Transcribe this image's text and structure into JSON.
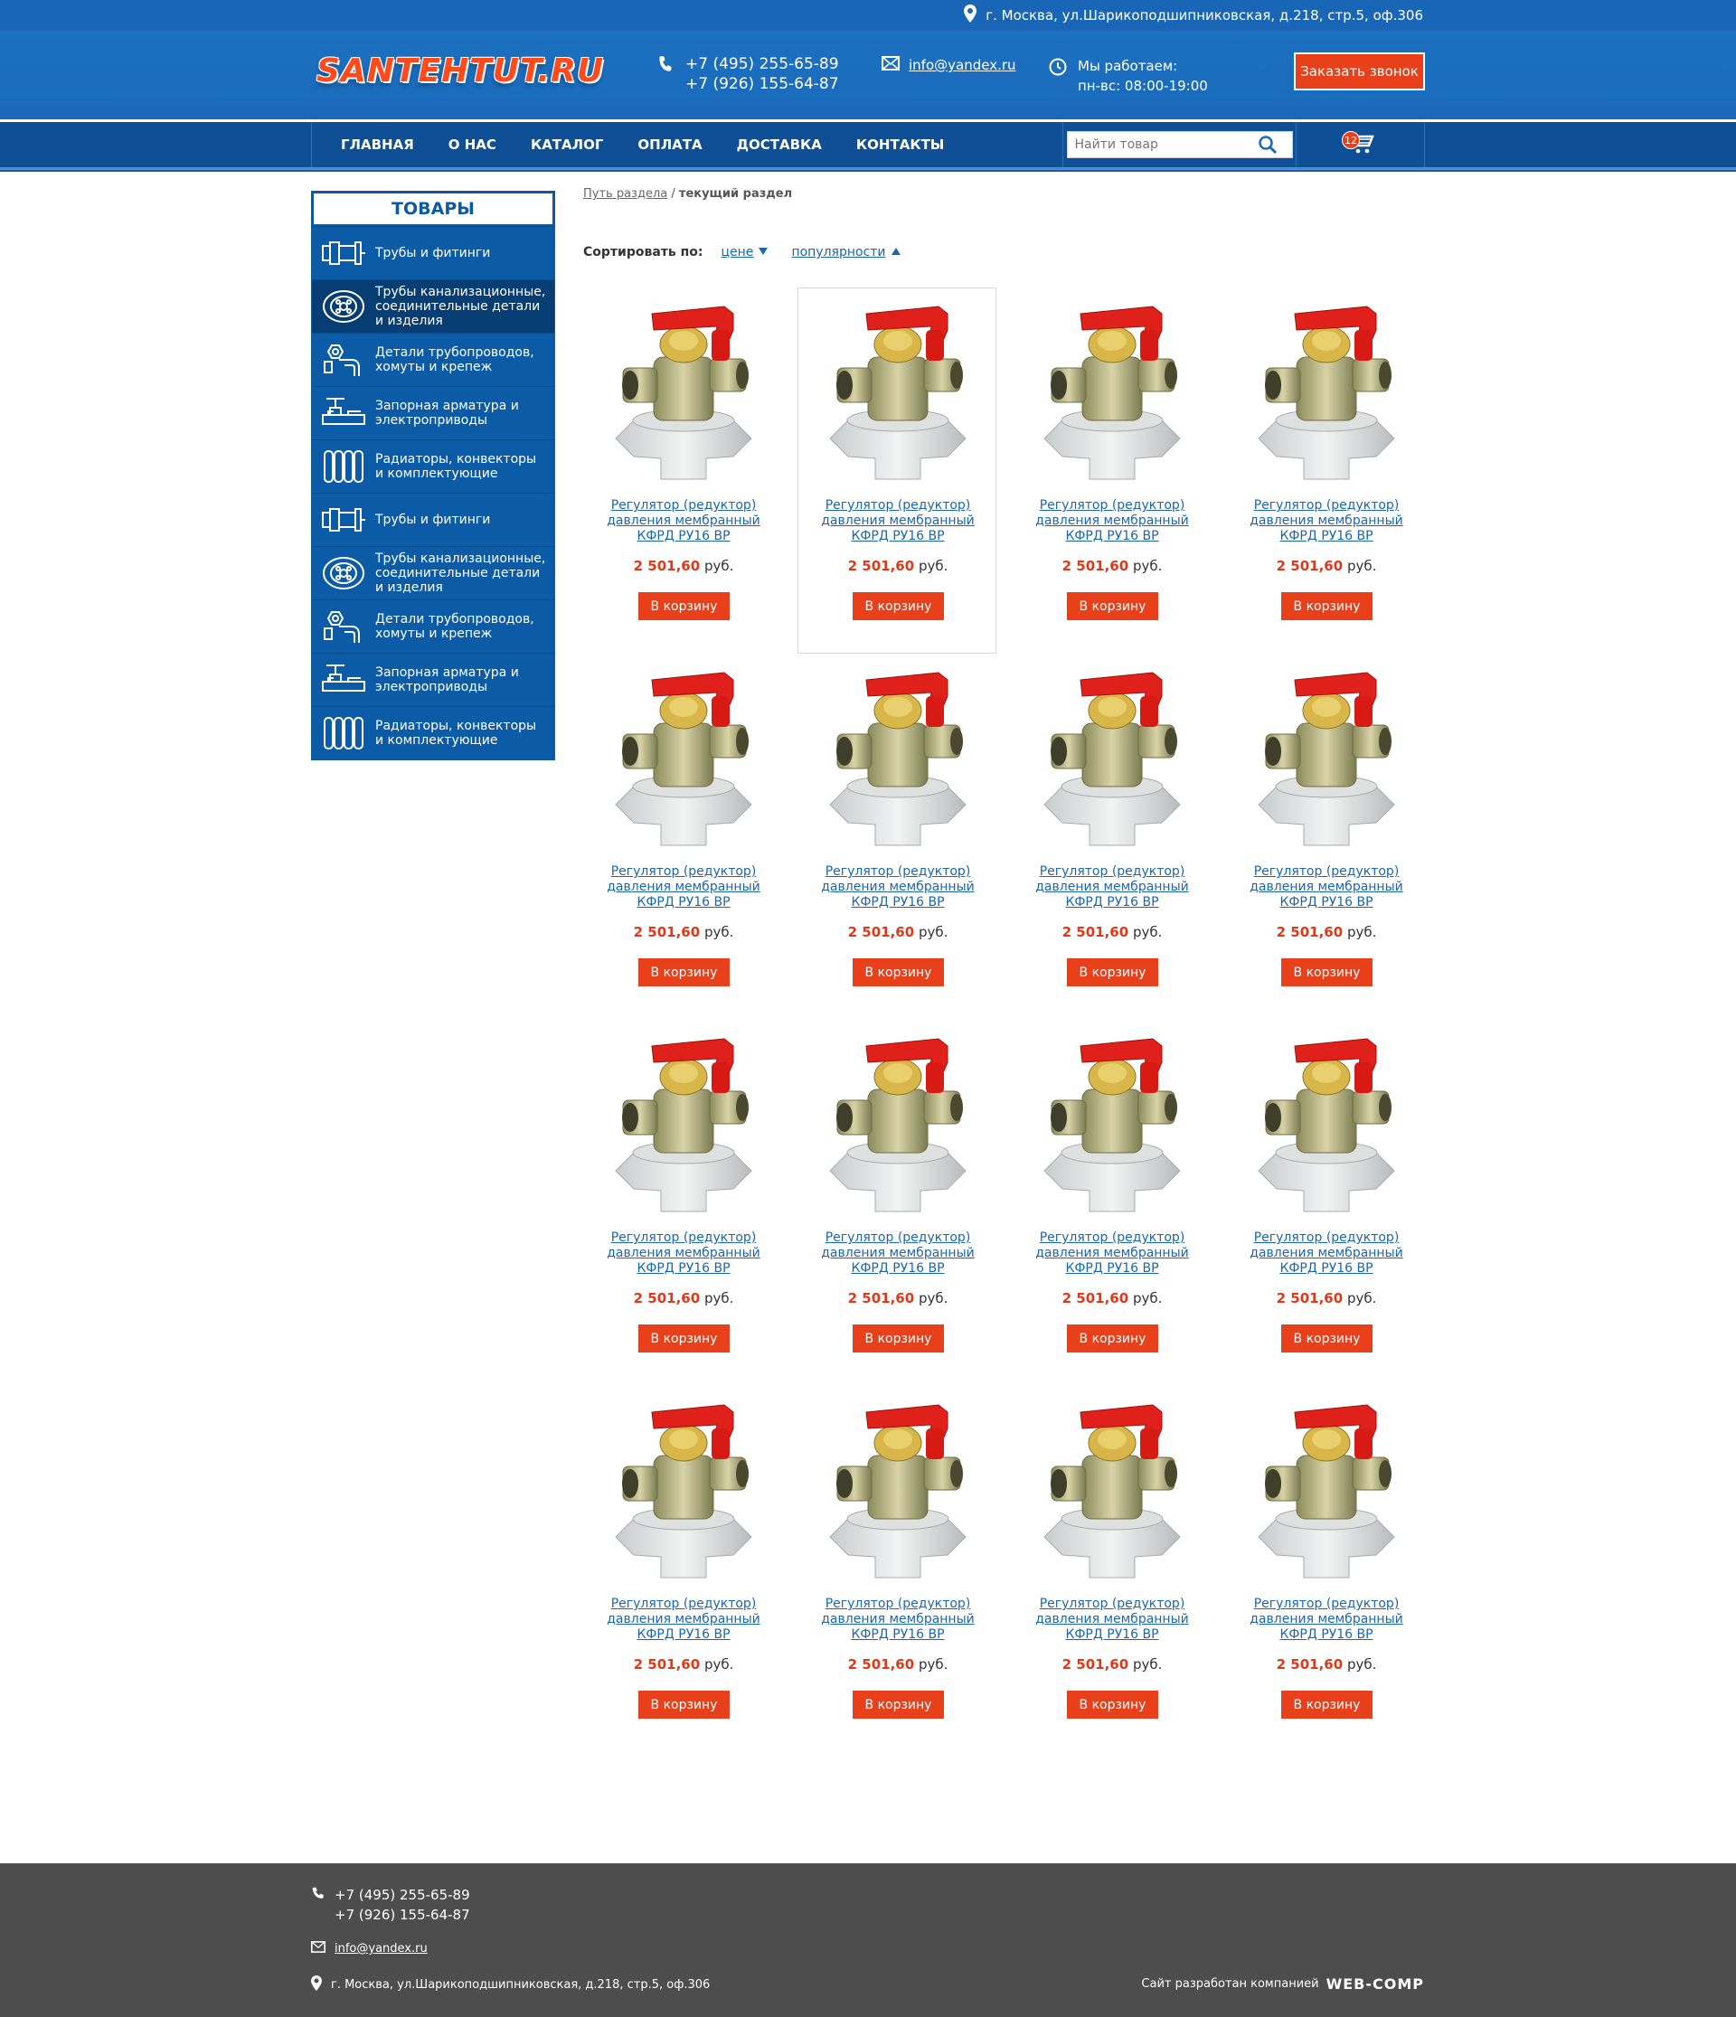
{
  "header": {
    "address": "г. Москва, ул.Шарикоподшипниковская, д.218, стр.5, оф.306",
    "logo": "SANTEHTUT.RU",
    "phone1": "+7 (495) 255-65-89",
    "phone2": "+7 (926) 155-64-87",
    "email": "info@yandex.ru",
    "hours_label": "Мы работаем:",
    "hours_value": "пн-вс: 08:00-19:00",
    "callback_label": "Заказать звонок"
  },
  "nav": {
    "items": [
      "ГЛАВНАЯ",
      "О НАС",
      "КАТАЛОГ",
      "ОПЛАТА",
      "ДОСТАВКА",
      "КОНТАКТЫ"
    ],
    "search_placeholder": "Найти товар",
    "cart_count": "12"
  },
  "sidebar": {
    "title": "ТОВАРЫ",
    "items": [
      {
        "label": "Трубы и фитинги",
        "icon": "pipe-fitting-icon"
      },
      {
        "label": "Трубы канализационные, соединительные детали и изделия",
        "icon": "sewer-pipe-icon"
      },
      {
        "label": "Детали трубопроводов, хомуты и крепеж",
        "icon": "pipe-parts-icon"
      },
      {
        "label": "Запорная арматура и электроприводы",
        "icon": "valve-icon"
      },
      {
        "label": "Радиаторы, конвекторы и комплектующие",
        "icon": "radiator-icon"
      },
      {
        "label": "Трубы и фитинги",
        "icon": "pipe-fitting-icon"
      },
      {
        "label": "Трубы канализационные, соединительные детали и изделия",
        "icon": "sewer-pipe-icon"
      },
      {
        "label": "Детали трубопроводов, хомуты и крепеж",
        "icon": "pipe-parts-icon"
      },
      {
        "label": "Запорная арматура и электроприводы",
        "icon": "valve-icon"
      },
      {
        "label": "Радиаторы, конвекторы и комплектующие",
        "icon": "radiator-icon"
      }
    ]
  },
  "breadcrumb": {
    "path": "Путь раздела",
    "separator": "/",
    "current": "текущий раздел"
  },
  "sort": {
    "label": "Сортировать по:",
    "by_price": "цене",
    "by_popularity": "популярности"
  },
  "product": {
    "title_line1": "Регулятор (редуктор)",
    "title_line2": "давления мембранный",
    "title_line3": "КФРД РУ16 ВР",
    "price": "2 501,60",
    "currency": "руб.",
    "buy_label": "В корзину"
  },
  "product_count": 16,
  "footer": {
    "phone1": "+7 (495) 255-65-89",
    "phone2": "+7 (926) 155-64-87",
    "email": "info@yandex.ru",
    "address": "г. Москва, ул.Шарикоподшипниковская, д.218, стр.5, оф.306",
    "developer_label": "Сайт разработан компанией",
    "developer_brand": "WEB-COMP"
  },
  "colors": {
    "brand_blue": "#1a6bbb",
    "nav_blue": "#0e4f96",
    "accent_red": "#e8401a"
  }
}
